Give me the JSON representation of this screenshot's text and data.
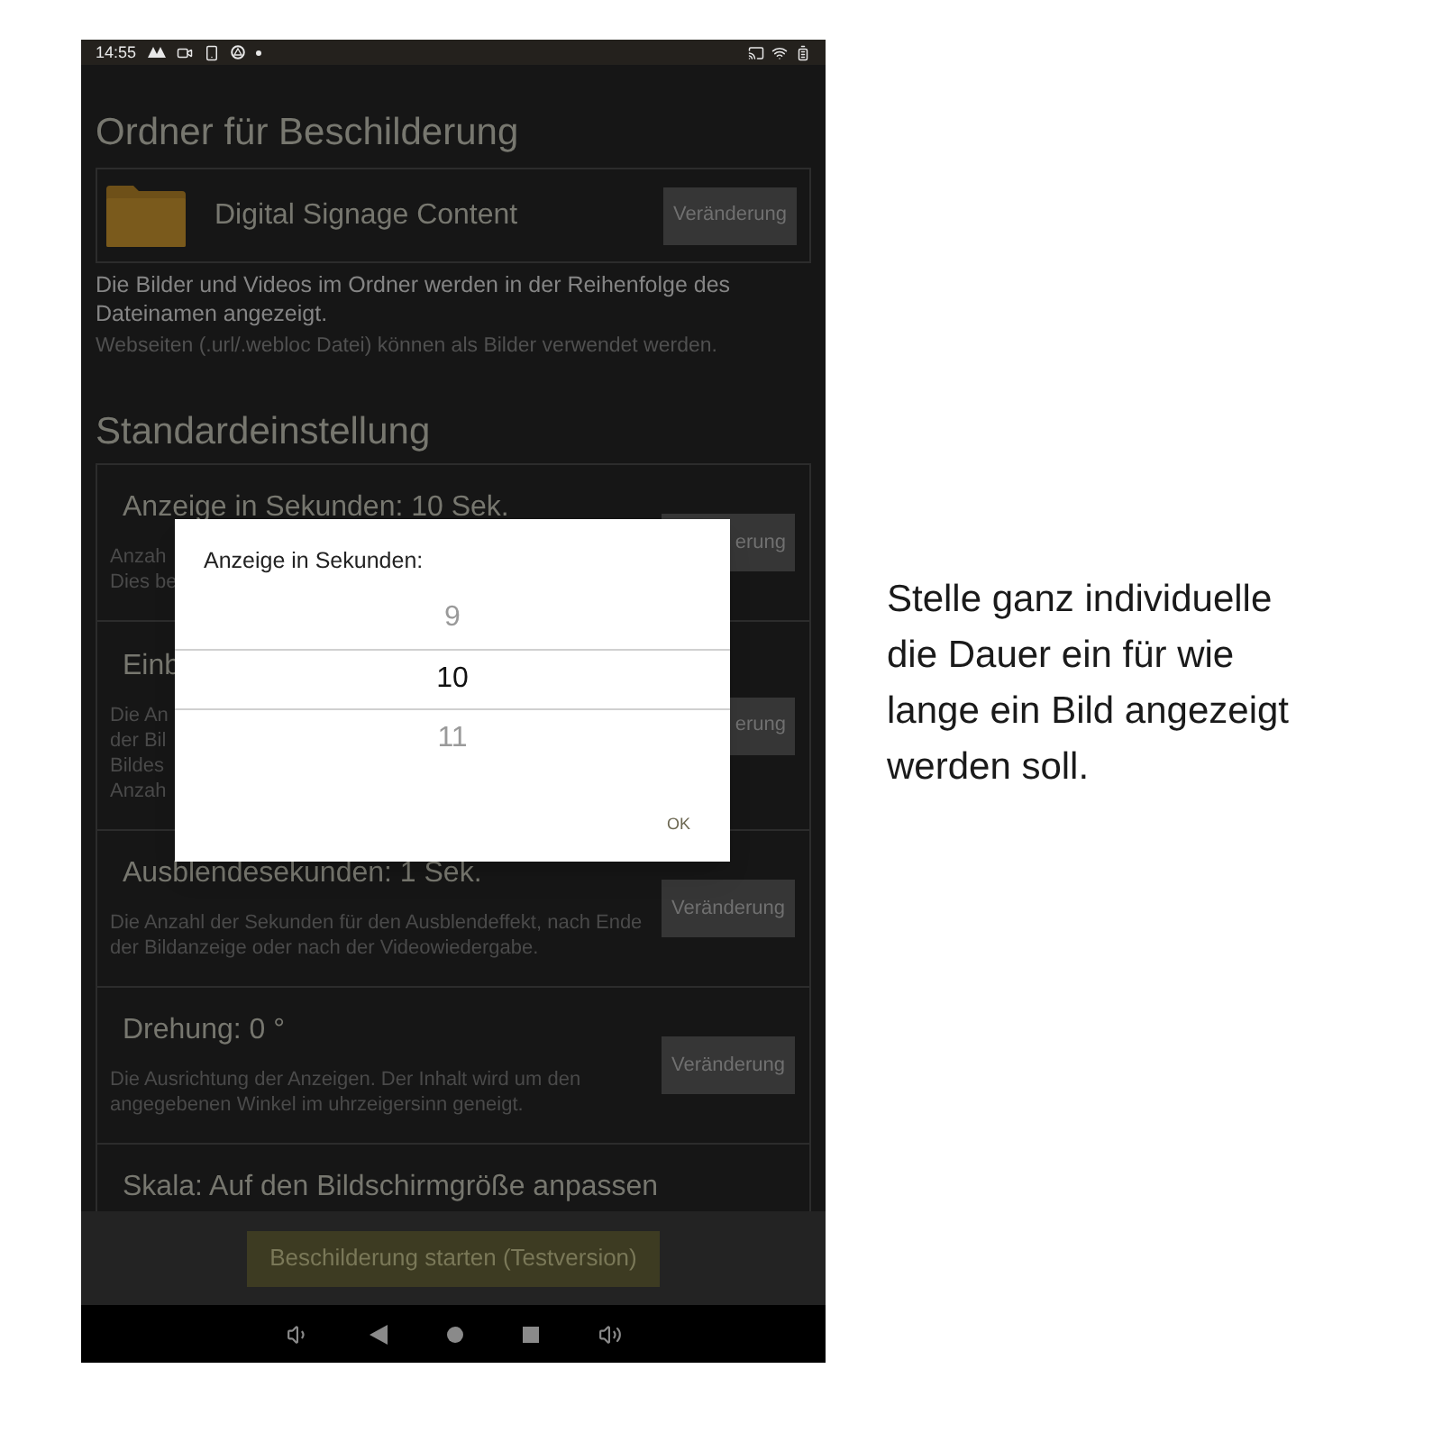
{
  "status_bar": {
    "time": "14:55"
  },
  "folder_section": {
    "heading": "Ordner für Beschilderung",
    "folder_name": "Digital Signage Content",
    "button": "Veränderung",
    "description": "Die Bilder und Videos im Ordner werden in der Reihenfolge des Dateinamen angezeigt.",
    "note": "Webseiten (.url/.webloc Datei) können als Bilder verwendet werden."
  },
  "settings": {
    "heading": "Standardeinstellung",
    "rows": [
      {
        "title": "Anzeige in Sekunden:  10 Sek.",
        "description_lines": [
          "Anzah",
          "Dies be"
        ],
        "button": "erung"
      },
      {
        "title": "Einb",
        "description_lines": [
          "Die An",
          "der Bil",
          "Bildes",
          "Anzah"
        ],
        "button": "erung"
      },
      {
        "title": "Ausblendesekunden:  1 Sek.",
        "description_lines": [
          "Die Anzahl der Sekunden für den Ausblendeffekt, nach Ende der Bildanzeige oder nach der Videowiedergabe."
        ],
        "button": "Veränderung"
      },
      {
        "title": "Drehung:  0 °",
        "description_lines": [
          "Die Ausrichtung der Anzeigen. Der Inhalt wird um den angegebenen Winkel im uhrzeigersinn geneigt."
        ],
        "button": "Veränderung"
      },
      {
        "title": "Skala:  Auf den Bildschirmgröße anpassen",
        "description_lines": []
      }
    ]
  },
  "dialog": {
    "title": "Anzeige in Sekunden:",
    "values": [
      {
        "label": "9",
        "selected": false
      },
      {
        "label": "10",
        "selected": true
      },
      {
        "label": "11",
        "selected": false
      }
    ],
    "ok_button": "OK"
  },
  "start_button": "Beschilderung starten (Testversion)",
  "caption": "Stelle ganz individuelle die Dauer ein für wie lange ein Bild angezeigt werden soll."
}
